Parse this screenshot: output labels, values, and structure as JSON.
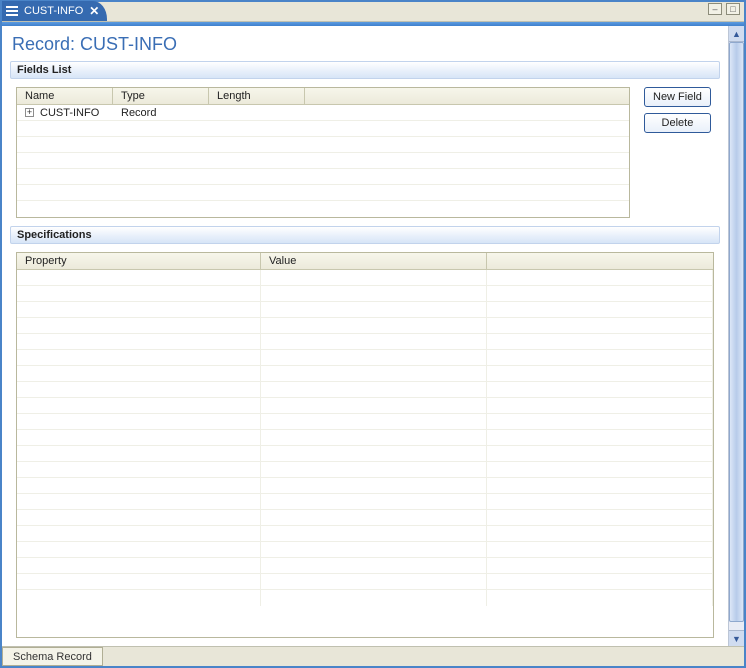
{
  "tab": {
    "label": "CUST-INFO"
  },
  "page_title": "Record: CUST-INFO",
  "fields_section_title": "Fields List",
  "spec_section_title": "Specifications",
  "fields_columns": {
    "name": "Name",
    "type": "Type",
    "length": "Length"
  },
  "fields_rows": [
    {
      "name": "CUST-INFO",
      "type": "Record",
      "length": ""
    }
  ],
  "spec_columns": {
    "property": "Property",
    "value": "Value"
  },
  "buttons": {
    "new_field": "New Field",
    "delete": "Delete"
  },
  "bottom_tab": "Schema Record"
}
